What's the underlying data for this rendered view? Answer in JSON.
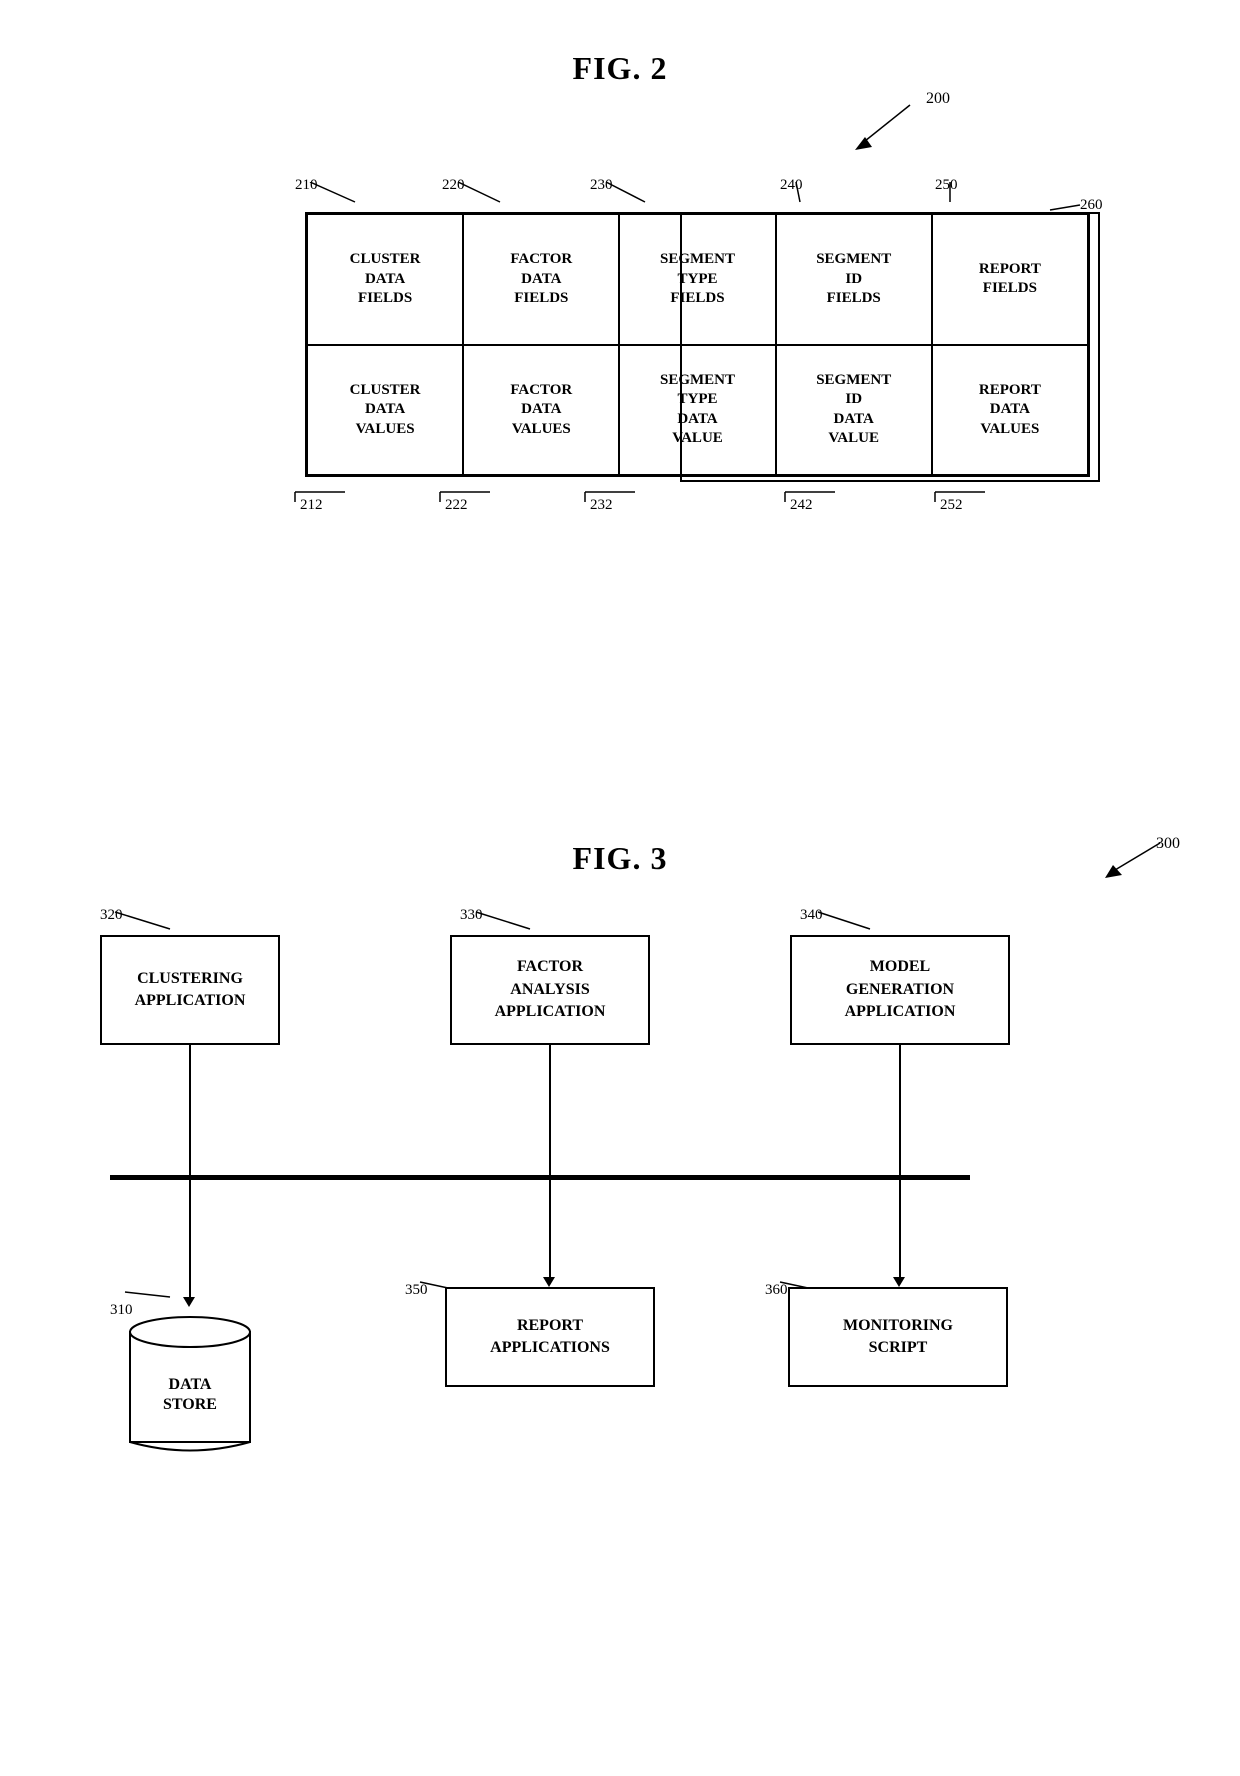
{
  "fig2": {
    "title": "FIG. 2",
    "ref_200": "200",
    "ref_260": "260",
    "ref_210": "210",
    "ref_220": "220",
    "ref_230": "230",
    "ref_240": "240",
    "ref_250": "250",
    "ref_212": "212",
    "ref_222": "222",
    "ref_232": "232",
    "ref_242": "242",
    "ref_252": "252",
    "cells": [
      "CLUSTER\nDATA\nFIELDS",
      "FACTOR\nDATA\nFIELDS",
      "SEGMENT\nTYPE\nFIELDS",
      "SEGMENT\nID\nFIELDS",
      "REPORT\nFIELDS",
      "CLUSTER\nDATA\nVALUES",
      "FACTOR\nDATA\nVALUES",
      "SEGMENT\nTYPE\nDATA\nVALUE",
      "SEGMENT\nID\nDATA\nVALUE",
      "REPORT\nDATA\nVALUES"
    ]
  },
  "fig3": {
    "title": "FIG. 3",
    "ref_300": "300",
    "ref_310": "310",
    "ref_320": "320",
    "ref_330": "330",
    "ref_340": "340",
    "ref_350": "350",
    "ref_360": "360",
    "clustering_app": "CLUSTERING\nAPPLICATION",
    "factor_analysis": "FACTOR\nANALYSIS\nAPPLICATION",
    "model_gen": "MODEL\nGENERATION\nAPPLICATION",
    "data_store": "DATA\nSTORE",
    "report_apps": "REPORT\nAPPLICATIONS",
    "monitoring": "MONITORING\nSCRIPT"
  }
}
